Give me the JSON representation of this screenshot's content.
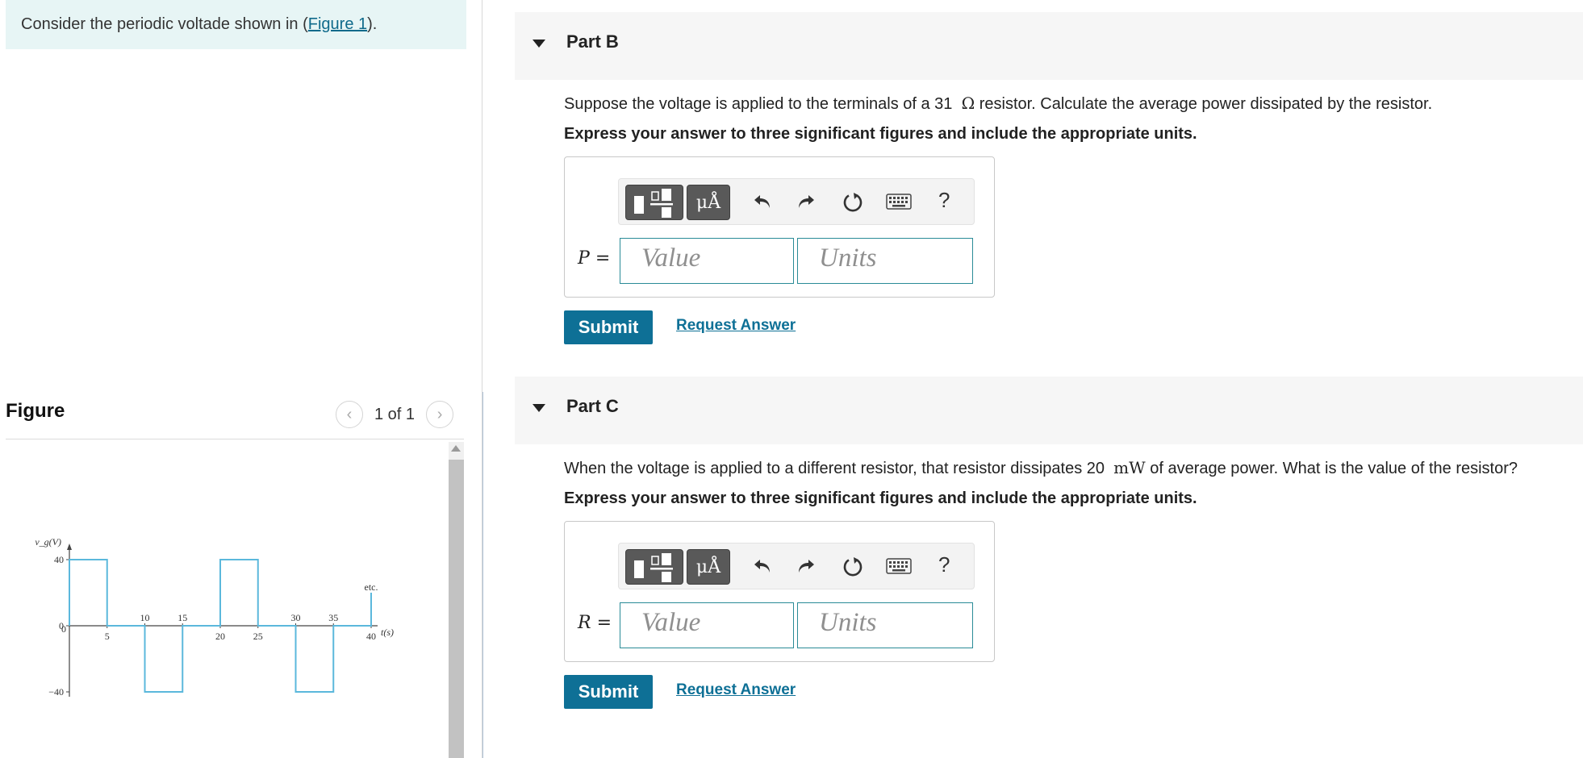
{
  "intro": {
    "prefix": "Consider the periodic voltade shown in (",
    "link": "Figure 1",
    "suffix": ")."
  },
  "figure_panel": {
    "title": "Figure",
    "pager": {
      "prev_icon": "chevron-left-icon",
      "count": "1 of 1",
      "next_icon": "chevron-right-icon"
    },
    "chart_data": {
      "type": "line",
      "ylabel": "v_g(V)",
      "xlabel": "t(s)",
      "y_ticks": [
        "40",
        "0",
        "−40"
      ],
      "x_ticks_above": [
        "10",
        "15",
        "30",
        "35"
      ],
      "x_ticks_below": [
        "5",
        "20",
        "25",
        "40"
      ],
      "annotation": "etc.",
      "ylim": [
        -40,
        40
      ],
      "xlim": [
        0,
        40
      ],
      "x": [
        0,
        0,
        5,
        5,
        10,
        10,
        15,
        15,
        20,
        20,
        25,
        25,
        30,
        30,
        35,
        35,
        40,
        40
      ],
      "y": [
        0,
        40,
        40,
        0,
        0,
        -40,
        -40,
        0,
        0,
        40,
        40,
        0,
        0,
        -40,
        -40,
        0,
        0,
        20
      ],
      "line_color": "#5bb8dc"
    }
  },
  "parts": [
    {
      "title": "Part B",
      "question_pre": "Suppose the voltage is applied to the terminals of a 31",
      "question_unit": "Ω",
      "question_post": "resistor. Calculate the average power dissipated by the resistor.",
      "instruction": "Express your answer to three significant figures and include the appropriate units.",
      "variable": "P",
      "equals": "=",
      "value_placeholder": "Value",
      "units_placeholder": "Units",
      "units_button": "μÅ",
      "help": "?",
      "submit": "Submit",
      "request": "Request Answer"
    },
    {
      "title": "Part C",
      "question_pre": "When the voltage is applied to a different resistor, that resistor dissipates 20",
      "question_unit": "mW",
      "question_post": "of average power. What is the value of the resistor?",
      "instruction": "Express your answer to three significant figures and include the appropriate units.",
      "variable": "R",
      "equals": "=",
      "value_placeholder": "Value",
      "units_placeholder": "Units",
      "units_button": "μÅ",
      "help": "?",
      "submit": "Submit",
      "request": "Request Answer"
    }
  ],
  "colors": {
    "accent": "#0e7096",
    "field_border": "#2a8b97",
    "intro_bg": "#e7f5f5"
  }
}
